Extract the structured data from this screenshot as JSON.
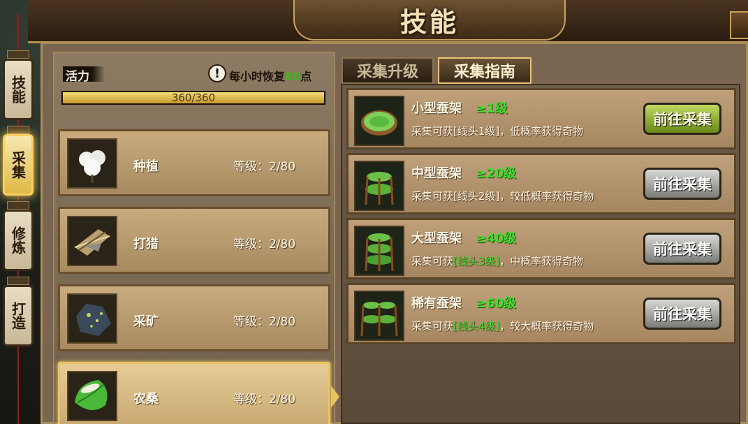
{
  "window": {
    "title": "技能"
  },
  "side_nav": [
    {
      "label": "技能",
      "active": false
    },
    {
      "label": "采集",
      "active": true
    },
    {
      "label": "修炼",
      "active": false
    },
    {
      "label": "打造",
      "active": false
    }
  ],
  "vitality": {
    "label": "活力",
    "recover_prefix": "每小时恢复",
    "recover_amount": "60",
    "recover_suffix": "点",
    "value_text": "360/360",
    "current": 360,
    "max": 360
  },
  "skills": [
    {
      "name": "种植",
      "level_text": "等级：2/80",
      "icon": "cotton-icon",
      "active": false
    },
    {
      "name": "打猎",
      "level_text": "等级：2/80",
      "icon": "hunting-icon",
      "active": false
    },
    {
      "name": "采矿",
      "level_text": "等级：2/80",
      "icon": "ore-icon",
      "active": false
    },
    {
      "name": "农桑",
      "level_text": "等级：2/80",
      "icon": "silkworm-leaf-icon",
      "active": true
    }
  ],
  "tabs": [
    {
      "label": "采集升级",
      "active": false
    },
    {
      "label": "采集指南",
      "active": true
    }
  ],
  "guide": [
    {
      "name": "小型蚕架",
      "req": "≥1级",
      "desc_prefix": "采集可获[线头1级]，低概率获得奇物",
      "desc_hl": "",
      "desc_suffix": "",
      "button": "前往采集",
      "button_style": "green",
      "icon": "small-silkworm-rack-icon"
    },
    {
      "name": "中型蚕架",
      "req": "≥20级",
      "desc_prefix": "采集可获[线头2级]，较低概率获得奇物",
      "desc_hl": "",
      "desc_suffix": "",
      "button": "前往采集",
      "button_style": "gray",
      "icon": "medium-silkworm-rack-icon"
    },
    {
      "name": "大型蚕架",
      "req": "≥40级",
      "desc_prefix": "采集可获",
      "desc_hl": "[线头3级]",
      "desc_suffix": "，中概率获得奇物",
      "button": "前往采集",
      "button_style": "gray",
      "icon": "large-silkworm-rack-icon"
    },
    {
      "name": "稀有蚕架",
      "req": "≥60级",
      "desc_prefix": "采集可获",
      "desc_hl": "[线头4级]",
      "desc_suffix": "，较大概率获得奇物",
      "button": "前往采集",
      "button_style": "gray",
      "icon": "rare-silkworm-rack-icon"
    }
  ],
  "colors": {
    "accent_green": "#3ae02a",
    "gold_border": "#e8c460",
    "panel_brown": "#a88a60"
  }
}
